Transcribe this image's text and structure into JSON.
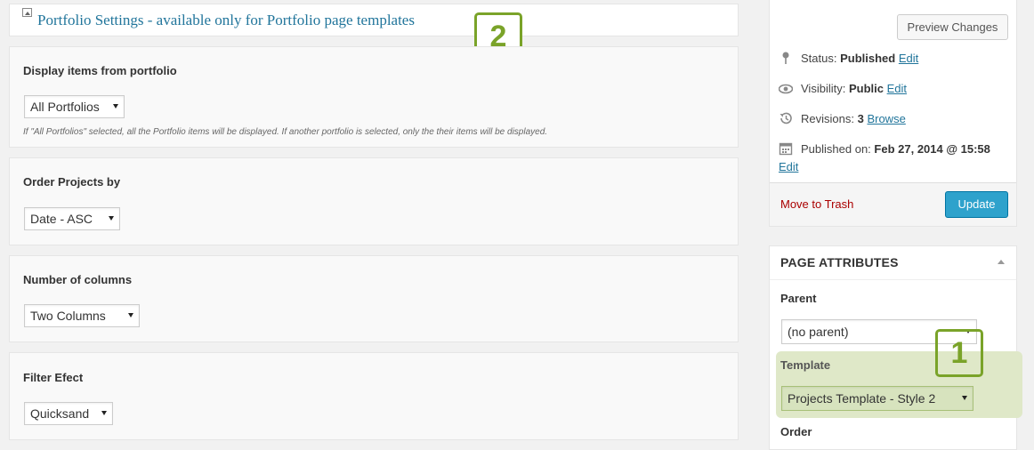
{
  "portfolio_settings": {
    "title": "Portfolio Settings - available only for Portfolio page templates",
    "badge": "2",
    "sections": [
      {
        "label": "Display items from portfolio",
        "selected": "All Portfolios",
        "hint": "If \"All Portfolios\" selected, all the Portfolio items will be displayed. If another portfolio is selected, only the their items will be displayed."
      },
      {
        "label": "Order Projects by",
        "selected": "Date - ASC"
      },
      {
        "label": "Number of columns",
        "selected": "Two Columns"
      },
      {
        "label": "Filter Efect",
        "selected": "Quicksand"
      }
    ]
  },
  "publish": {
    "preview_label": "Preview Changes",
    "status_label": "Status:",
    "status_value": "Published",
    "visibility_label": "Visibility:",
    "visibility_value": "Public",
    "revisions_label": "Revisions:",
    "revisions_value": "3",
    "browse_label": "Browse",
    "published_on_label": "Published on:",
    "published_on_value": "Feb 27, 2014 @ 15:58",
    "edit_label": "Edit",
    "trash_label": "Move to Trash",
    "update_label": "Update"
  },
  "page_attributes": {
    "title": "PAGE ATTRIBUTES",
    "parent_label": "Parent",
    "parent_value": "(no parent)",
    "template_label": "Template",
    "template_value": "Projects Template - Style 2",
    "order_label": "Order",
    "badge": "1"
  },
  "colors": {
    "link": "#21759b",
    "badge_green": "#7aa329",
    "update_blue": "#2ea2cc",
    "trash_red": "#a00"
  }
}
